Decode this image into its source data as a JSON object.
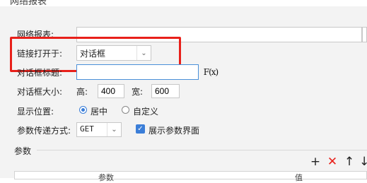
{
  "window": {
    "title": "网络报表"
  },
  "form": {
    "report_label": "网络报表:",
    "open_in_label": "链接打开于:",
    "open_in_value": "对话框",
    "dialog_title_label": "对话框标题:",
    "dialog_title_value": "",
    "formula_button": "F(x)",
    "dialog_size_label": "对话框大小:",
    "height_label": "高:",
    "height_value": "400",
    "width_label": "宽:",
    "width_value": "600",
    "position_label": "显示位置:",
    "position_center": "居中",
    "position_custom": "自定义",
    "param_method_label": "参数传递方式:",
    "param_method_value": "GET",
    "show_param_ui_label": "展示参数界面"
  },
  "params": {
    "section_label": "参数",
    "col_name": "参数",
    "col_value": "值"
  },
  "colors": {
    "highlight": "#e8201a",
    "accent": "#3b7ed8"
  }
}
